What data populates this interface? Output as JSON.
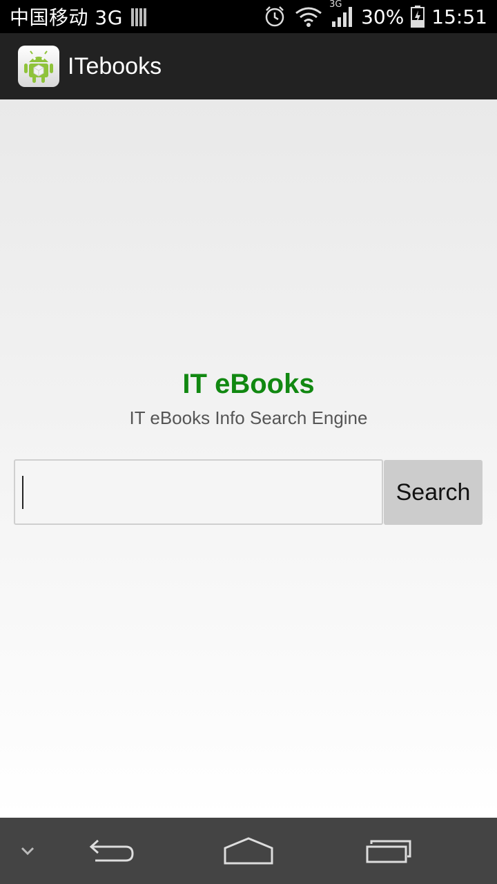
{
  "status_bar": {
    "carrier": "中国移动 3G",
    "network_type": "3G",
    "battery": "30%",
    "time": "15:51",
    "icons": [
      "sim-icon",
      "alarm-icon",
      "wifi-icon",
      "signal-icon",
      "battery-charging-icon"
    ]
  },
  "action_bar": {
    "app_icon": "android-app-icon",
    "title": "ITebooks"
  },
  "main": {
    "heading": "IT eBooks",
    "subheading": "IT eBooks Info Search Engine",
    "search_input": {
      "value": "",
      "placeholder": ""
    },
    "search_button": "Search"
  },
  "nav_bar": {
    "icons": [
      "chevron-down-icon",
      "back-icon",
      "home-icon",
      "recent-apps-icon"
    ]
  },
  "colors": {
    "heading": "#118811",
    "action_bar": "#222222",
    "nav_bar": "#444444"
  }
}
